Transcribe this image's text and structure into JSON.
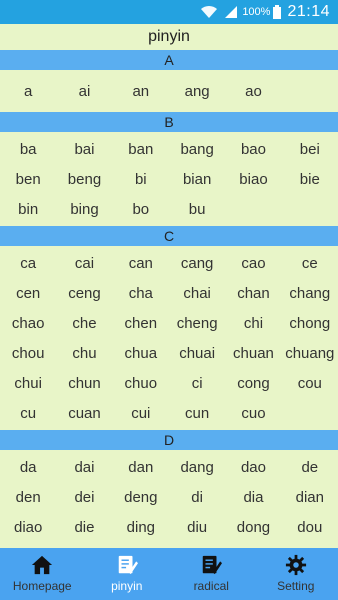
{
  "status_bar": {
    "battery": "100%",
    "time": "21:14"
  },
  "title": "pinyin",
  "sections": [
    {
      "letter": "A",
      "rows": [
        [
          "a",
          "ai",
          "an",
          "ang",
          "ao"
        ]
      ]
    },
    {
      "letter": "B",
      "rows": [
        [
          "ba",
          "bai",
          "ban",
          "bang",
          "bao",
          "bei"
        ],
        [
          "ben",
          "beng",
          "bi",
          "bian",
          "biao",
          "bie"
        ],
        [
          "bin",
          "bing",
          "bo",
          "bu"
        ]
      ]
    },
    {
      "letter": "C",
      "rows": [
        [
          "ca",
          "cai",
          "can",
          "cang",
          "cao",
          "ce"
        ],
        [
          "cen",
          "ceng",
          "cha",
          "chai",
          "chan",
          "chang"
        ],
        [
          "chao",
          "che",
          "chen",
          "cheng",
          "chi",
          "chong"
        ],
        [
          "chou",
          "chu",
          "chua",
          "chuai",
          "chuan",
          "chuang"
        ],
        [
          "chui",
          "chun",
          "chuo",
          "ci",
          "cong",
          "cou"
        ],
        [
          "cu",
          "cuan",
          "cui",
          "cun",
          "cuo"
        ]
      ]
    },
    {
      "letter": "D",
      "rows": [
        [
          "da",
          "dai",
          "dan",
          "dang",
          "dao",
          "de"
        ],
        [
          "den",
          "dei",
          "deng",
          "di",
          "dia",
          "dian"
        ],
        [
          "diao",
          "die",
          "ding",
          "diu",
          "dong",
          "dou"
        ]
      ]
    }
  ],
  "nav": [
    {
      "label": "Homepage",
      "icon": "home-icon"
    },
    {
      "label": "pinyin",
      "icon": "pinyin-icon"
    },
    {
      "label": "radical",
      "icon": "radical-icon"
    },
    {
      "label": "Setting",
      "icon": "gear-icon"
    }
  ],
  "colors": {
    "status_bar": "#24a2e0",
    "background": "#e8f5c8",
    "section_header": "#5aaef0",
    "bottom_nav": "#4aa3f0"
  }
}
